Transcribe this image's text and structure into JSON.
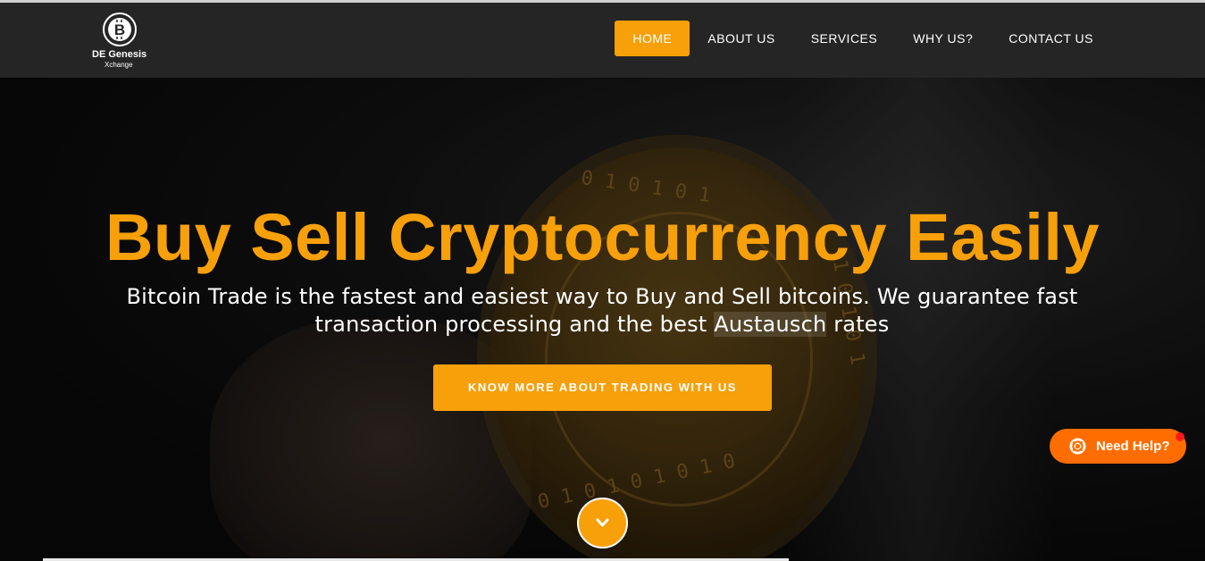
{
  "brand": {
    "name": "DE Genesis",
    "sub": "Xchange",
    "icon": "bitcoin-logo-icon",
    "color_accent": "#f7a00a",
    "color_header": "#252525"
  },
  "nav": {
    "items": [
      {
        "label": "HOME",
        "active": true
      },
      {
        "label": "ABOUT US",
        "active": false
      },
      {
        "label": "SERVICES",
        "active": false
      },
      {
        "label": "WHY US?",
        "active": false
      },
      {
        "label": "CONTACT US",
        "active": false
      }
    ]
  },
  "hero": {
    "title": "Buy Sell Cryptocurrency Easily",
    "text_part1": "Bitcoin Trade is the fastest and easiest way to Buy and Sell bitcoins. We guarantee fast transaction processing and the best ",
    "text_highlight": "Austausch",
    "text_part2": " rates",
    "cta_label": "KNOW MORE ABOUT TRADING WITH US",
    "scroll_icon": "chevron-down-icon"
  },
  "help_widget": {
    "label": "Need Help?",
    "icon": "lifebuoy-icon",
    "color": "#ff6d00",
    "notification_color": "#ff1b1b"
  }
}
